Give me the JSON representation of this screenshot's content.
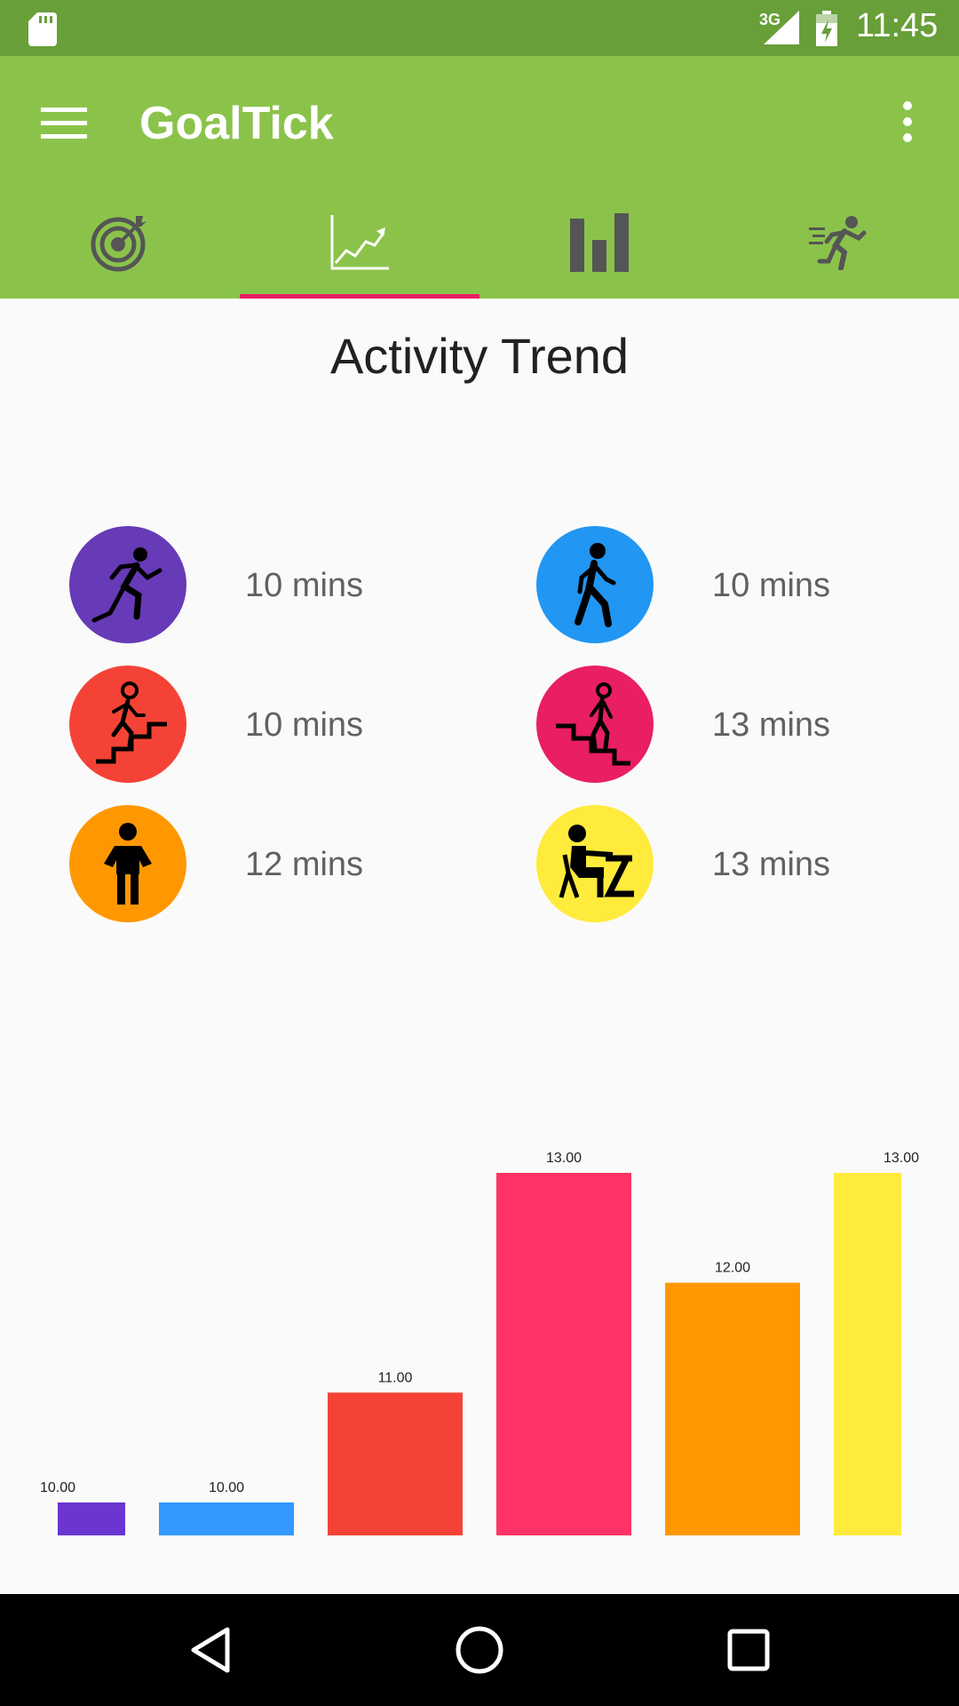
{
  "status_bar": {
    "network": "3G",
    "time": "11:45",
    "icons": [
      "sd-card-icon",
      "signal-icon",
      "battery-charging-icon"
    ]
  },
  "app_bar": {
    "title": "GoalTick",
    "icons": [
      "menu-icon",
      "more-vert-icon"
    ]
  },
  "tabs": [
    {
      "name": "goals",
      "icon": "target-icon",
      "selected": false
    },
    {
      "name": "trend",
      "icon": "trend-chart-icon",
      "selected": true
    },
    {
      "name": "stats",
      "icon": "bar-chart-icon",
      "selected": false
    },
    {
      "name": "activity",
      "icon": "running-icon",
      "selected": false
    }
  ],
  "page": {
    "heading": "Activity Trend",
    "activities": [
      {
        "icon": "running-icon",
        "color": "#673ab7",
        "value": "10 mins"
      },
      {
        "icon": "walking-icon",
        "color": "#2196f3",
        "value": "10 mins"
      },
      {
        "icon": "stairs-up-icon",
        "color": "#f44336",
        "value": "10 mins"
      },
      {
        "icon": "stairs-down-icon",
        "color": "#e91e63",
        "value": "13 mins"
      },
      {
        "icon": "standing-icon",
        "color": "#ff9800",
        "value": "12 mins"
      },
      {
        "icon": "sitting-desk-icon",
        "color": "#ffeb3b",
        "value": "13 mins"
      }
    ]
  },
  "chart_data": {
    "type": "bar",
    "values": [
      10.0,
      10.0,
      11.0,
      13.0,
      12.0,
      13.0
    ],
    "labels": [
      "10.00",
      "10.00",
      "11.00",
      "13.00",
      "12.00",
      "13.00"
    ],
    "colors": [
      "#6a35d0",
      "#3399ff",
      "#f44336",
      "#ff3366",
      "#ff9800",
      "#ffeb3b"
    ],
    "ylim": [
      9.7,
      13
    ]
  },
  "nav_bar": {
    "icons": [
      "back-icon",
      "home-icon",
      "recents-icon"
    ]
  }
}
